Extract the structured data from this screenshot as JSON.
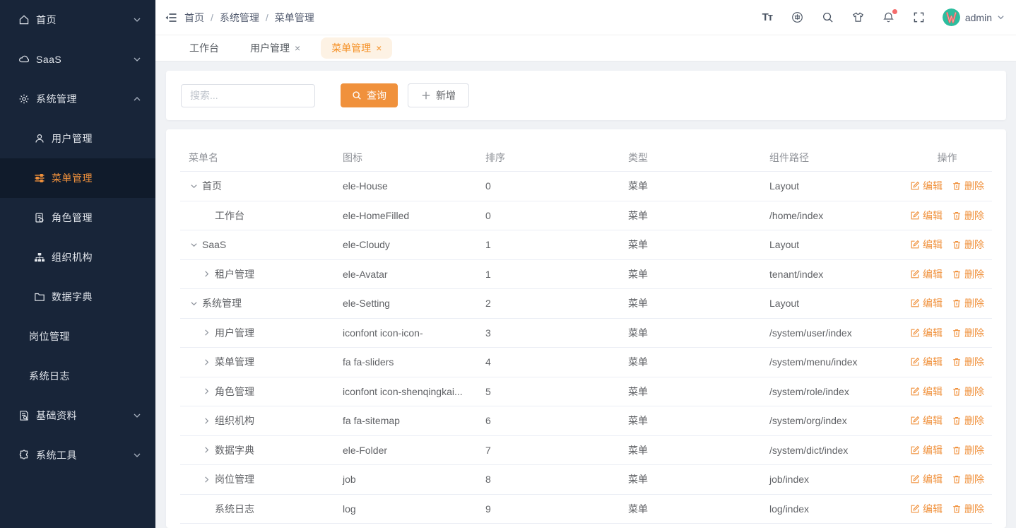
{
  "accent": "#f0913c",
  "sidebar": {
    "items": [
      {
        "label": "首页",
        "icon": "home-icon",
        "level": 0,
        "chevron": "down"
      },
      {
        "label": "SaaS",
        "icon": "cloud-icon",
        "level": 0,
        "chevron": "down"
      },
      {
        "label": "系统管理",
        "icon": "gear-icon",
        "level": 0,
        "chevron": "up"
      },
      {
        "label": "用户管理",
        "icon": "user-icon",
        "level": 1
      },
      {
        "label": "菜单管理",
        "icon": "sliders-icon",
        "level": 1,
        "active": true
      },
      {
        "label": "角色管理",
        "icon": "role-icon",
        "level": 1
      },
      {
        "label": "组织机构",
        "icon": "sitemap-icon",
        "level": 1
      },
      {
        "label": "数据字典",
        "icon": "folder-icon",
        "level": 1
      },
      {
        "label": "岗位管理",
        "level": 1,
        "noicon": true
      },
      {
        "label": "系统日志",
        "level": 1,
        "noicon": true
      },
      {
        "label": "基础资料",
        "icon": "document-search-icon",
        "level": 0,
        "chevron": "down"
      },
      {
        "label": "系统工具",
        "icon": "tools-icon",
        "level": 0,
        "chevron": "down"
      }
    ]
  },
  "header": {
    "breadcrumb": [
      "首页",
      "系统管理",
      "菜单管理"
    ],
    "font_size_icon_text": "Tᴛ",
    "user": "admin"
  },
  "tabs": [
    {
      "label": "工作台",
      "closable": false,
      "active": false
    },
    {
      "label": "用户管理",
      "closable": true,
      "active": false
    },
    {
      "label": "菜单管理",
      "closable": true,
      "active": true
    }
  ],
  "toolbar": {
    "search_placeholder": "搜索...",
    "query_label": "查询",
    "add_label": "新增"
  },
  "table": {
    "columns": [
      "菜单名",
      "图标",
      "排序",
      "类型",
      "组件路径",
      "操作"
    ],
    "edit_label": "编辑",
    "delete_label": "删除",
    "rows": [
      {
        "name": "首页",
        "arrow": "down",
        "level": 0,
        "icon": "ele-House",
        "sort": "0",
        "type": "菜单",
        "path": "Layout"
      },
      {
        "name": "工作台",
        "arrow": "none",
        "level": 1,
        "icon": "ele-HomeFilled",
        "sort": "0",
        "type": "菜单",
        "path": "/home/index"
      },
      {
        "name": "SaaS",
        "arrow": "down",
        "level": 0,
        "icon": "ele-Cloudy",
        "sort": "1",
        "type": "菜单",
        "path": "Layout"
      },
      {
        "name": "租户管理",
        "arrow": "right",
        "level": 1,
        "icon": "ele-Avatar",
        "sort": "1",
        "type": "菜单",
        "path": "tenant/index"
      },
      {
        "name": "系统管理",
        "arrow": "down",
        "level": 0,
        "icon": "ele-Setting",
        "sort": "2",
        "type": "菜单",
        "path": "Layout"
      },
      {
        "name": "用户管理",
        "arrow": "right",
        "level": 1,
        "icon": "iconfont icon-icon-",
        "sort": "3",
        "type": "菜单",
        "path": "/system/user/index"
      },
      {
        "name": "菜单管理",
        "arrow": "right",
        "level": 1,
        "icon": "fa fa-sliders",
        "sort": "4",
        "type": "菜单",
        "path": "/system/menu/index"
      },
      {
        "name": "角色管理",
        "arrow": "right",
        "level": 1,
        "icon": "iconfont icon-shenqingkai...",
        "sort": "5",
        "type": "菜单",
        "path": "/system/role/index"
      },
      {
        "name": "组织机构",
        "arrow": "right",
        "level": 1,
        "icon": "fa fa-sitemap",
        "sort": "6",
        "type": "菜单",
        "path": "/system/org/index"
      },
      {
        "name": "数据字典",
        "arrow": "right",
        "level": 1,
        "icon": "ele-Folder",
        "sort": "7",
        "type": "菜单",
        "path": "/system/dict/index"
      },
      {
        "name": "岗位管理",
        "arrow": "right",
        "level": 1,
        "icon": "job",
        "sort": "8",
        "type": "菜单",
        "path": "job/index"
      },
      {
        "name": "系统日志",
        "arrow": "none",
        "level": 1,
        "icon": "log",
        "sort": "9",
        "type": "菜单",
        "path": "log/index"
      }
    ]
  }
}
